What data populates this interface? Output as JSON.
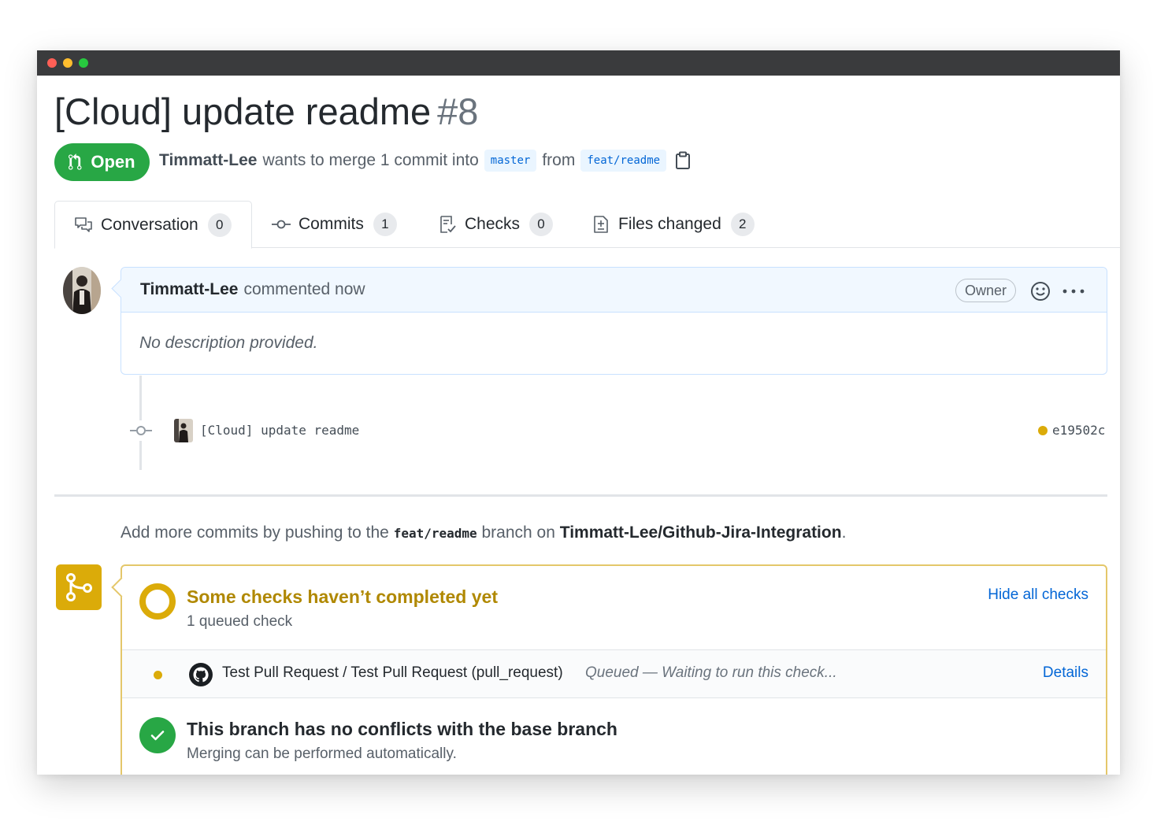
{
  "pr": {
    "title": "[Cloud] update readme",
    "number": "#8",
    "state": "Open",
    "author": "Timmatt-Lee",
    "meta_text": "wants to merge 1 commit into",
    "base_branch": "master",
    "from_text": "from",
    "head_branch": "feat/readme"
  },
  "tabs": [
    {
      "label": "Conversation",
      "count": "0",
      "icon": "comment-discussion-icon"
    },
    {
      "label": "Commits",
      "count": "1",
      "icon": "git-commit-icon"
    },
    {
      "label": "Checks",
      "count": "0",
      "icon": "checklist-icon"
    },
    {
      "label": "Files changed",
      "count": "2",
      "icon": "file-diff-icon"
    }
  ],
  "comment": {
    "author": "Timmatt-Lee",
    "time_text": "commented now",
    "role_label": "Owner",
    "body": "No description provided."
  },
  "commit": {
    "message": "[Cloud] update readme",
    "sha": "e19502c",
    "status_color": "#dbab09"
  },
  "push_hint": {
    "prefix": "Add more commits by pushing to the",
    "branch": "feat/readme",
    "middle": "branch on",
    "repo": "Timmatt-Lee/Github-Jira-Integration",
    "suffix": "."
  },
  "checks": {
    "title": "Some checks haven’t completed yet",
    "subtitle": "1 queued check",
    "toggle_label": "Hide all checks",
    "items": [
      {
        "name": "Test Pull Request / Test Pull Request (pull_request)",
        "status": "Queued — Waiting to run this check...",
        "details_label": "Details"
      }
    ]
  },
  "merge": {
    "title": "This branch has no conflicts with the base branch",
    "subtitle": "Merging can be performed automatically."
  },
  "colors": {
    "open_green": "#28a745",
    "pending_yellow": "#dbab09",
    "link_blue": "#0366d6"
  }
}
